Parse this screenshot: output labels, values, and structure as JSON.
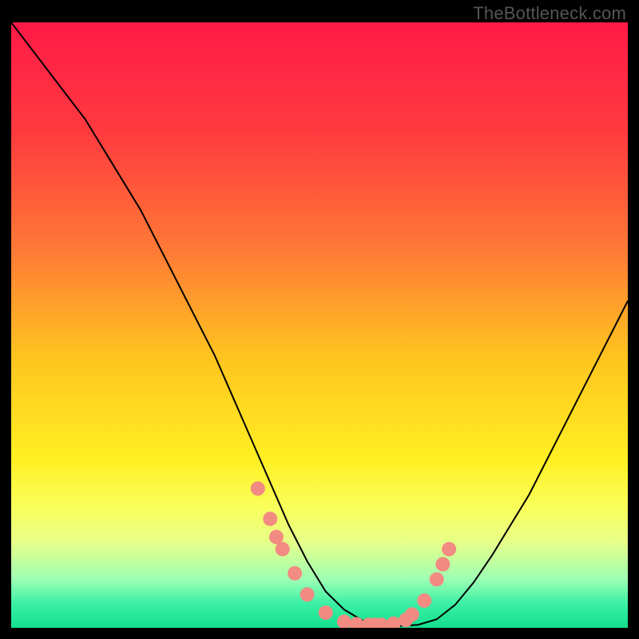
{
  "watermark": "TheBottleneck.com",
  "chart_data": {
    "type": "line",
    "title": "",
    "xlabel": "",
    "ylabel": "",
    "xlim": [
      0,
      100
    ],
    "ylim": [
      0,
      100
    ],
    "background_gradient": {
      "stops": [
        {
          "offset": 0,
          "color": "#ff1a47"
        },
        {
          "offset": 18,
          "color": "#ff3a3f"
        },
        {
          "offset": 38,
          "color": "#ff7b36"
        },
        {
          "offset": 55,
          "color": "#ffc31f"
        },
        {
          "offset": 72,
          "color": "#ffef22"
        },
        {
          "offset": 80,
          "color": "#f9ff5a"
        },
        {
          "offset": 86,
          "color": "#e6ff8a"
        },
        {
          "offset": 92,
          "color": "#9cffb4"
        },
        {
          "offset": 96,
          "color": "#3cf0a5"
        },
        {
          "offset": 100,
          "color": "#12e08f"
        }
      ]
    },
    "series": [
      {
        "name": "bottleneck-curve",
        "color": "#000000",
        "x": [
          0,
          3,
          6,
          9,
          12,
          15,
          18,
          21,
          24,
          27,
          30,
          33,
          36,
          39,
          42,
          45,
          48,
          51,
          54,
          57,
          60,
          63,
          66,
          69,
          72,
          75,
          78,
          81,
          84,
          87,
          90,
          93,
          96,
          100
        ],
        "y": [
          100,
          96,
          92,
          88,
          84,
          79,
          74,
          69,
          63,
          57,
          51,
          45,
          38,
          31,
          24,
          17,
          11,
          6,
          3,
          1.2,
          0.4,
          0.3,
          0.5,
          1.4,
          3.8,
          7.5,
          12,
          17,
          22,
          28,
          34,
          40,
          46,
          54
        ]
      }
    ],
    "markers": {
      "name": "highlighted-points",
      "color": "#f28b82",
      "radius": 9,
      "x": [
        40,
        42,
        43,
        44,
        46,
        48,
        51,
        54,
        56,
        58,
        59,
        60,
        62,
        64,
        65,
        67,
        69,
        70,
        71
      ],
      "y": [
        23,
        18,
        15,
        13,
        9,
        5.5,
        2.5,
        1,
        0.6,
        0.5,
        0.5,
        0.5,
        0.7,
        1.3,
        2.2,
        4.5,
        8,
        10.5,
        13
      ]
    }
  }
}
